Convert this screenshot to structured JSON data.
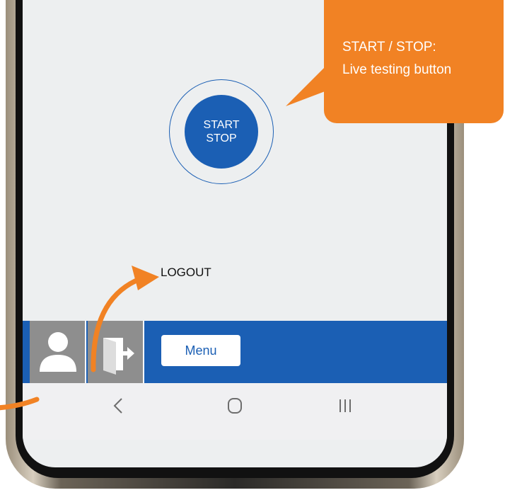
{
  "main": {
    "start_button": {
      "line1": "START",
      "line2": "STOP"
    }
  },
  "annotations": {
    "logout_label": "LOGOUT",
    "callout": {
      "line1": "START / STOP:",
      "line2": "Live testing button"
    }
  },
  "bottom_bar": {
    "menu_label": "Menu",
    "icons": [
      "user-icon",
      "logout-icon"
    ]
  },
  "nav": {
    "icons": [
      "back-icon",
      "home-icon",
      "recents-icon"
    ]
  },
  "colors": {
    "accent_blue": "#1b5fb4",
    "callout_orange": "#f18224",
    "icon_button_gray": "#8e8e8e",
    "screen_background": "#edeff0"
  }
}
